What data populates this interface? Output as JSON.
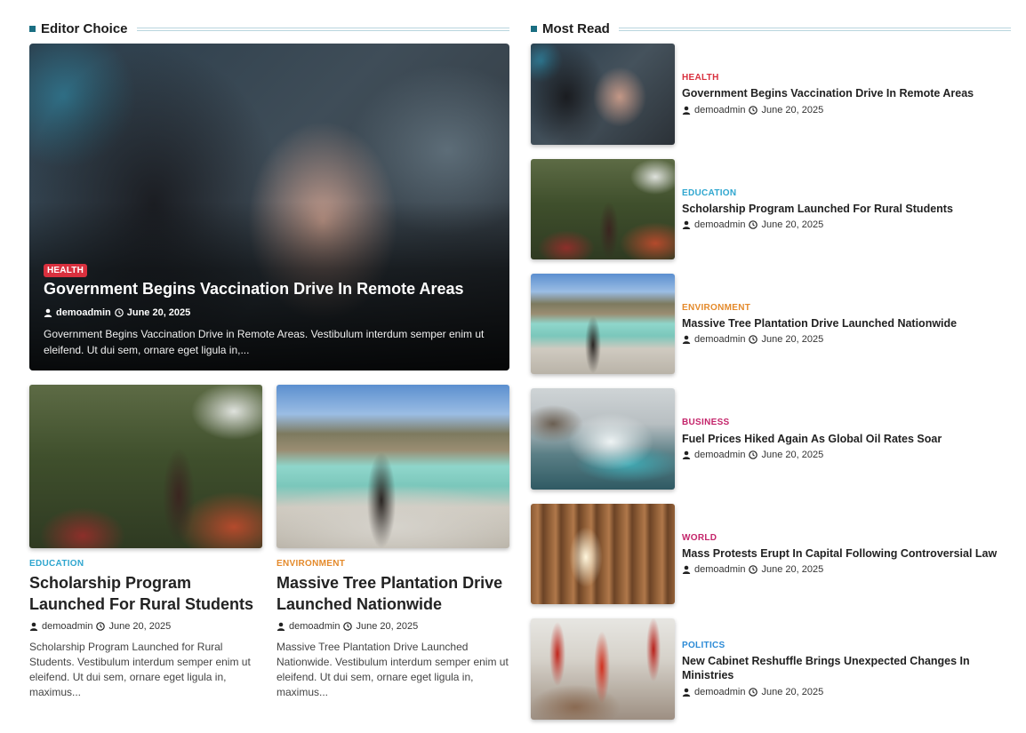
{
  "editor_choice": {
    "heading": "Editor Choice",
    "featured": {
      "category": "HEALTH",
      "title": "Government Begins Vaccination Drive In Remote Areas",
      "author": "demoadmin",
      "date": "June 20, 2025",
      "excerpt": "Government Begins Vaccination Drive in Remote Areas. Vestibulum interdum semper enim ut eleifend. Ut dui sem, ornare eget ligula in,..."
    },
    "cards": [
      {
        "category": "EDUCATION",
        "title": "Scholarship Program Launched For Rural Students",
        "author": "demoadmin",
        "date": "June 20, 2025",
        "excerpt": "Scholarship Program Launched for Rural Students. Vestibulum interdum semper enim ut eleifend. Ut dui sem, ornare eget ligula in, maximus..."
      },
      {
        "category": "ENVIRONMENT",
        "title": "Massive Tree Plantation Drive Launched Nationwide",
        "author": "demoadmin",
        "date": "June 20, 2025",
        "excerpt": "Massive Tree Plantation Drive Launched Nationwide. Vestibulum interdum semper enim ut eleifend. Ut dui sem, ornare eget ligula in, maximus..."
      }
    ]
  },
  "most_read": {
    "heading": "Most Read",
    "items": [
      {
        "category": "HEALTH",
        "title": "Government Begins Vaccination Drive In Remote Areas",
        "author": "demoadmin",
        "date": "June 20, 2025"
      },
      {
        "category": "EDUCATION",
        "title": "Scholarship Program Launched For Rural Students",
        "author": "demoadmin",
        "date": "June 20, 2025"
      },
      {
        "category": "ENVIRONMENT",
        "title": "Massive Tree Plantation Drive Launched Nationwide",
        "author": "demoadmin",
        "date": "June 20, 2025"
      },
      {
        "category": "BUSINESS",
        "title": "Fuel Prices Hiked Again As Global Oil Rates Soar",
        "author": "demoadmin",
        "date": "June 20, 2025"
      },
      {
        "category": "WORLD",
        "title": "Mass Protests Erupt In Capital Following Controversial Law",
        "author": "demoadmin",
        "date": "June 20, 2025"
      },
      {
        "category": "POLITICS",
        "title": "New Cabinet Reshuffle Brings Unexpected Changes In Ministries",
        "author": "demoadmin",
        "date": "June 20, 2025"
      }
    ]
  },
  "icons": {
    "author": "user-icon",
    "date": "clock-icon"
  },
  "colors": {
    "accent": "#1a6e82",
    "health": "#d9303e",
    "education": "#2fa6cf",
    "environment": "#e48a2b",
    "business": "#c4246a",
    "world": "#c4246a",
    "politics": "#2b8ad6"
  }
}
